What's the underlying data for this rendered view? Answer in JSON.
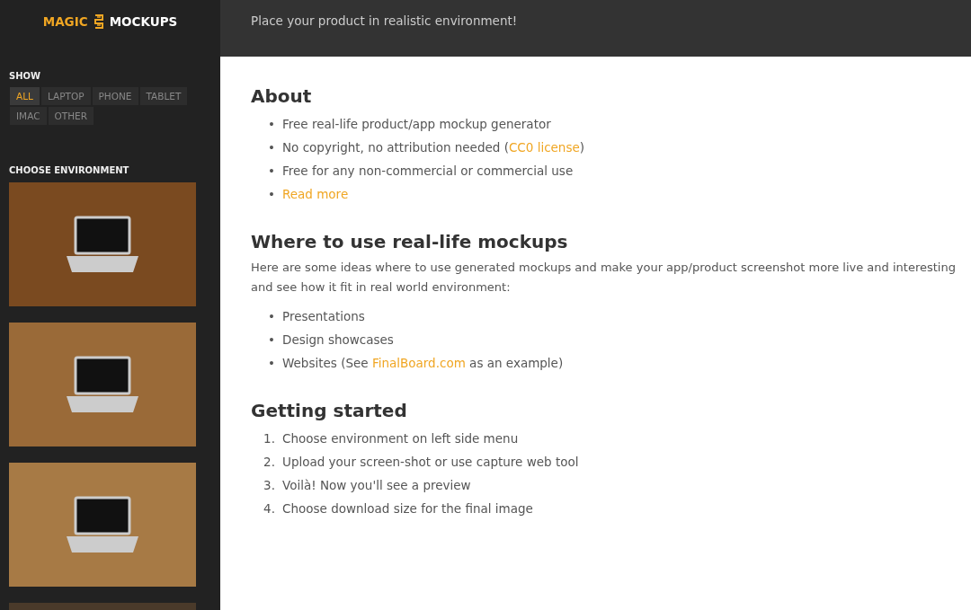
{
  "logo": {
    "word_1": "MAGIC",
    "word_2": "MOCKUPS"
  },
  "tagline": "Place your product in realistic environment!",
  "sidebar": {
    "show_heading": "SHOW",
    "filters": [
      {
        "label": "ALL",
        "selected": true
      },
      {
        "label": "LAPTOP",
        "selected": false
      },
      {
        "label": "PHONE",
        "selected": false
      },
      {
        "label": "TABLET",
        "selected": false
      },
      {
        "label": "IMAC",
        "selected": false
      },
      {
        "label": "OTHER",
        "selected": false
      }
    ],
    "environment_heading": "CHOOSE ENVIRONMENT",
    "environments": [
      {
        "color": "#7a4a20"
      },
      {
        "color": "#9a6a38"
      },
      {
        "color": "#a77a45"
      },
      {
        "color": "#4a3a2a"
      }
    ]
  },
  "sections": [
    {
      "title": "About",
      "items": [
        {
          "marker": "•",
          "parts": [
            {
              "kind": "text",
              "text": "Free real-life product/app mockup generator"
            }
          ]
        },
        {
          "marker": "•",
          "parts": [
            {
              "kind": "text",
              "text": "No copyright, no attribution needed ("
            },
            {
              "kind": "link",
              "text": "CC0 license"
            },
            {
              "kind": "text",
              "text": ")"
            }
          ]
        },
        {
          "marker": "•",
          "parts": [
            {
              "kind": "text",
              "text": "Free for any non-commercial or commercial use"
            }
          ]
        },
        {
          "marker": "•",
          "parts": [
            {
              "kind": "link",
              "text": "Read more"
            }
          ]
        }
      ]
    },
    {
      "title": "Where to use real-life mockups",
      "intro": "Here are some ideas where to use generated mockups and make your app/product screenshot more live and interesting and see how it fit in real world environment:",
      "items": [
        {
          "marker": "•",
          "parts": [
            {
              "kind": "text",
              "text": "Presentations"
            }
          ]
        },
        {
          "marker": "•",
          "parts": [
            {
              "kind": "text",
              "text": "Design showcases"
            }
          ]
        },
        {
          "marker": "•",
          "parts": [
            {
              "kind": "text",
              "text": "Websites (See "
            },
            {
              "kind": "link",
              "text": "FinalBoard.com"
            },
            {
              "kind": "text",
              "text": " as an example)"
            }
          ]
        }
      ]
    },
    {
      "title": "Getting started",
      "items": [
        {
          "marker": "1.",
          "parts": [
            {
              "kind": "text",
              "text": "Choose environment on left side menu"
            }
          ]
        },
        {
          "marker": "2.",
          "parts": [
            {
              "kind": "text",
              "text": "Upload your screen-shot or use capture web tool"
            }
          ]
        },
        {
          "marker": "3.",
          "parts": [
            {
              "kind": "text",
              "text": "Voilà! Now you'll see a preview"
            }
          ]
        },
        {
          "marker": "4.",
          "parts": [
            {
              "kind": "text",
              "text": "Choose download size for the final image"
            }
          ]
        }
      ]
    }
  ]
}
